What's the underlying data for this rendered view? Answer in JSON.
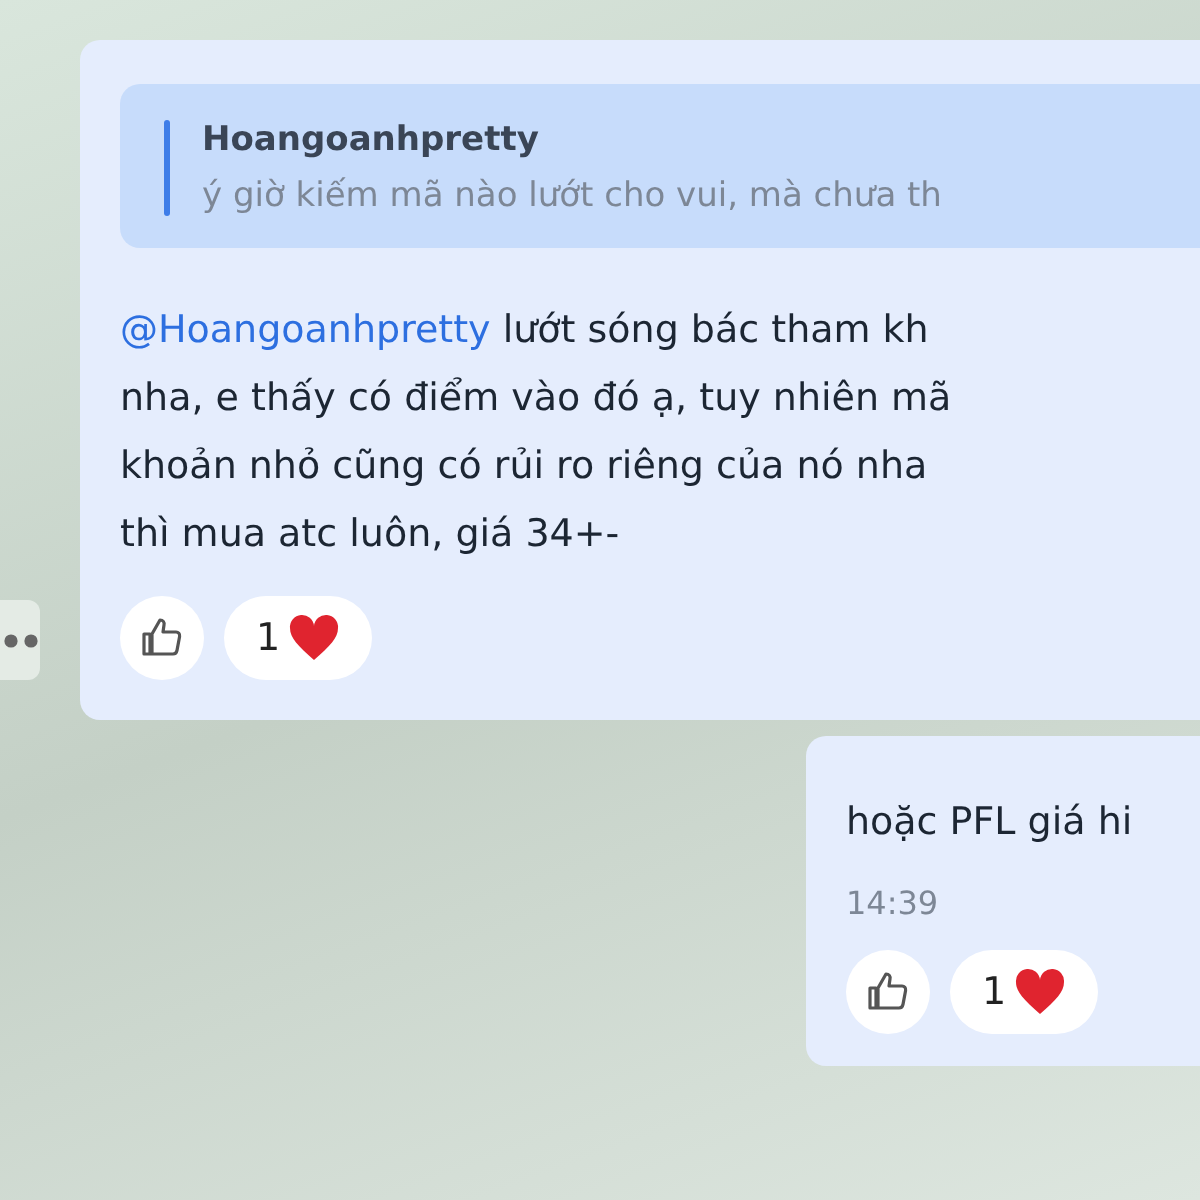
{
  "messages": [
    {
      "quote": {
        "author": "Hoangoanhpretty",
        "text": "ý giờ kiếm mã nào lướt cho vui, mà chưa th"
      },
      "mention": "@Hoangoanhpretty",
      "text": " lướt sóng bác tham kh\nnha, e thấy có điểm vào đó ạ, tuy nhiên mã\nkhoản nhỏ cũng có rủi ro riêng của nó nha\nthì mua atc luôn, giá 34+-",
      "reactions": [
        {
          "kind": "like"
        },
        {
          "kind": "heart",
          "label": "1"
        }
      ],
      "outgoing": false
    },
    {
      "text": "hoặc PFL giá hi",
      "time": "14:39",
      "reactions": [
        {
          "kind": "like"
        },
        {
          "kind": "heart",
          "label": "1"
        }
      ],
      "outgoing": true
    }
  ]
}
